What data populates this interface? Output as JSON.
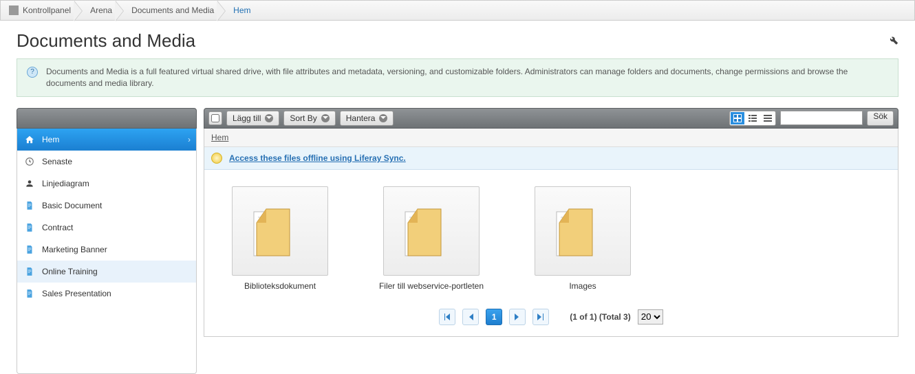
{
  "breadcrumb": {
    "items": [
      {
        "label": "Kontrollpanel"
      },
      {
        "label": "Arena"
      },
      {
        "label": "Documents and Media"
      },
      {
        "label": "Hem"
      }
    ]
  },
  "page": {
    "title": "Documents and Media",
    "info": "Documents and Media is a full featured virtual shared drive, with file attributes and metadata, versioning, and customizable folders. Administrators can manage folders and documents, change permissions and browse the documents and media library."
  },
  "toolbar": {
    "add_label": "Lägg till",
    "sort_label": "Sort By",
    "manage_label": "Hantera",
    "search_label": "Sök",
    "search_placeholder": ""
  },
  "sidebar": {
    "items": [
      {
        "label": "Hem",
        "icon": "home-icon",
        "active": true
      },
      {
        "label": "Senaste",
        "icon": "clock-icon"
      },
      {
        "label": "Linjediagram",
        "icon": "person-icon"
      },
      {
        "label": "Basic Document",
        "icon": "doc-icon"
      },
      {
        "label": "Contract",
        "icon": "doc-icon"
      },
      {
        "label": "Marketing Banner",
        "icon": "doc-icon"
      },
      {
        "label": "Online Training",
        "icon": "doc-icon",
        "hover": true
      },
      {
        "label": "Sales Presentation",
        "icon": "doc-icon"
      }
    ]
  },
  "main": {
    "path_label": "Hem",
    "sync_label": "Access these files offline using Liferay Sync.",
    "folders": [
      {
        "label": "Biblioteksdokument"
      },
      {
        "label": "Filer till webservice-portleten"
      },
      {
        "label": "Images"
      }
    ],
    "pager": {
      "current": "1",
      "info": "(1 of 1) (Total 3)",
      "per_page": "20"
    }
  }
}
